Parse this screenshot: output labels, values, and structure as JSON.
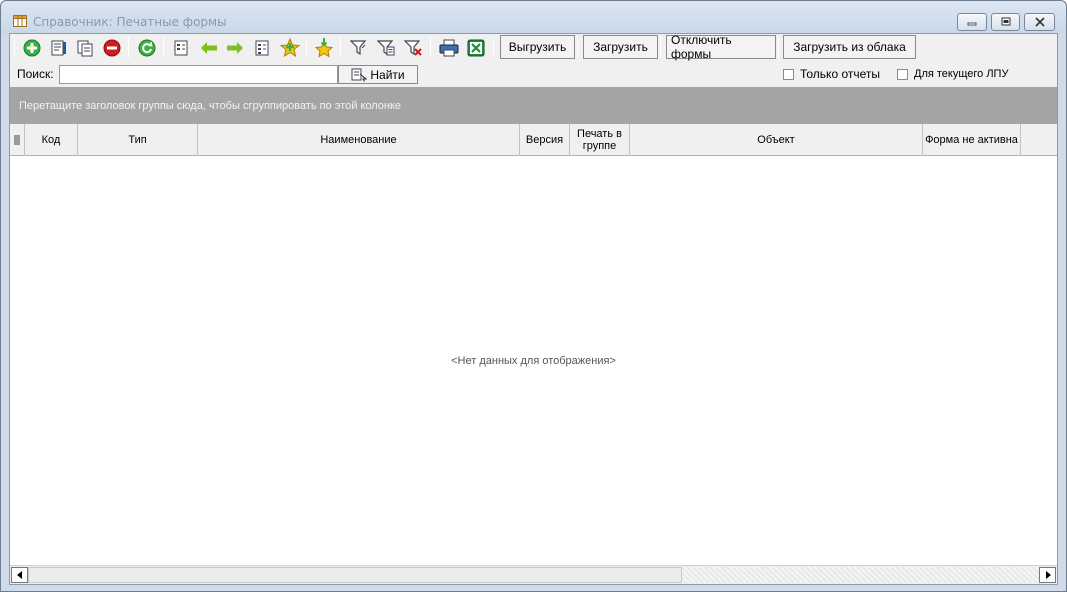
{
  "window": {
    "title": "Справочник: Печатные формы",
    "icon": "grid-icon"
  },
  "toolbar": {
    "icons": [
      "add-icon",
      "edit-icon",
      "copy-icon",
      "delete-icon",
      "refresh-icon",
      "view-icon",
      "left-arrow-icon",
      "right-arrow-icon",
      "list-icon",
      "favorite-add-icon",
      "favorite-icon",
      "filter-icon",
      "filter-edit-icon",
      "filter-clear-icon",
      "print-icon",
      "excel-icon"
    ],
    "export_label": "Выгрузить",
    "import_label": "Загрузить",
    "disable_forms_label": "Отключить формы",
    "cloud_import_label": "Загрузить из облака"
  },
  "search": {
    "label": "Поиск:",
    "value": "",
    "find_label": "Найти",
    "only_reports_label": "Только отчеты",
    "current_lpu_label": "Для текущего ЛПУ",
    "only_reports_checked": false,
    "current_lpu_checked": false
  },
  "grid": {
    "group_hint": "Перетащите заголовок группы сюда, чтобы сгруппировать по этой колонке",
    "columns": [
      "Код",
      "Тип",
      "Наименование",
      "Версия",
      "Печать в группе",
      "Объект",
      "Форма не активна"
    ],
    "rows": [],
    "empty_text": "<Нет данных для отображения>"
  },
  "colors": {
    "titlebar": "#cfdbe9",
    "group_bar": "#a4a4a4",
    "accent_green": "#3cb043",
    "accent_red": "#d01c1c"
  }
}
